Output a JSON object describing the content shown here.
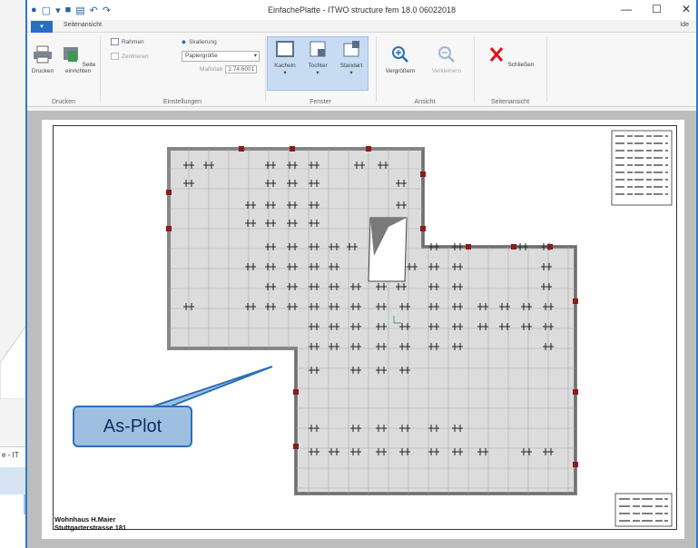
{
  "app": {
    "title": "EinfachePlatte - ITWO structure fem 18.0 06022018",
    "file_tab": "",
    "tab": "Seitenansicht",
    "help": "Ide",
    "window_controls": [
      "—",
      "☐",
      "✕"
    ]
  },
  "background": {
    "window_title_fragment": "e - IT"
  },
  "ribbon": {
    "groups": [
      {
        "label": "Drucken"
      },
      {
        "label": "Einstellungen"
      },
      {
        "label": "Fenster"
      },
      {
        "label": "Ansicht"
      },
      {
        "label": "Seitenansicht"
      }
    ],
    "print": {
      "label": "Drucken"
    },
    "page_setup": {
      "label": "Seite einrichten"
    },
    "options": {
      "rahmen": "Rahmen",
      "zentrieren": "Zentrieren",
      "skalierung": "Skalierung",
      "papiergroesse": "Papiergröße",
      "massstab_label": "Maßstab",
      "massstab_value": "1:74.6001"
    },
    "window_buttons": [
      "Kacheln",
      "Tochter",
      "Standart"
    ],
    "view_buttons": [
      "Vergrößern",
      "Verkleinern"
    ],
    "close": "Schließen"
  },
  "drawing": {
    "footer_line1": "Wohnhaus H.Maier",
    "footer_line2": "Stuttgarterstrasse 181"
  },
  "callout": {
    "text": "As-Plot"
  },
  "colors": {
    "accent": "#2b79d0",
    "callout_fill": "#9fbfe0",
    "callout_border": "#2f6fb7",
    "close_red": "#d9141b"
  }
}
